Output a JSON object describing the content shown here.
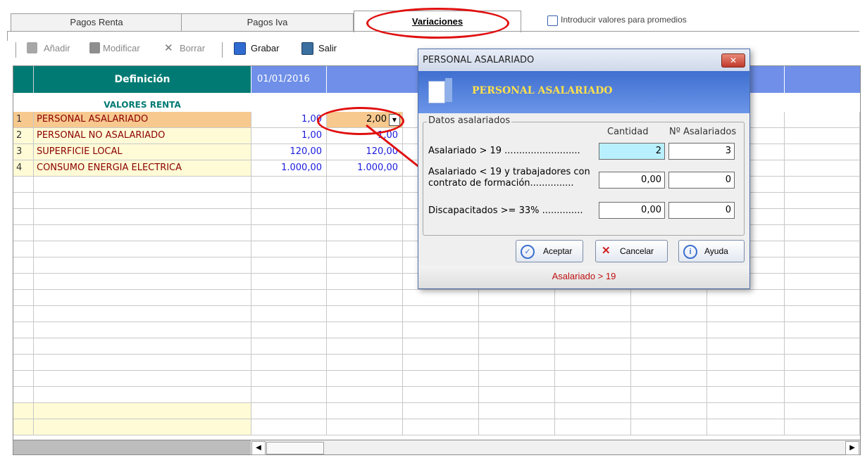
{
  "tabs": [
    {
      "label": "Pagos Renta"
    },
    {
      "label": "Pagos Iva"
    },
    {
      "label": "Variaciones"
    }
  ],
  "options": {
    "promedios_label": "Introducir valores para promedios"
  },
  "toolbar": {
    "add_label": "Añadir",
    "modify_label": "Modificar",
    "delete_label": "Borrar",
    "save_label": "Grabar",
    "exit_label": "Salir"
  },
  "grid": {
    "header": {
      "definicion": "Definición",
      "col1": "01/01/2016"
    },
    "section_title": "VALORES RENTA",
    "rows": [
      {
        "n": "1",
        "label": "PERSONAL ASALARIADO",
        "v1": "1,00",
        "v2": "2,00"
      },
      {
        "n": "2",
        "label": "PERSONAL NO ASALARIADO",
        "v1": "1,00",
        "v2": "1,00"
      },
      {
        "n": "3",
        "label": "SUPERFICIE LOCAL",
        "v1": "120,00",
        "v2": "120,00"
      },
      {
        "n": "4",
        "label": "CONSUMO ENERGIA ELECTRICA",
        "v1": "1.000,00",
        "v2": "1.000,00"
      }
    ]
  },
  "dialog": {
    "title": "PERSONAL ASALARIADO",
    "banner": "PERSONAL ASALARIADO",
    "group_label": "Datos asalariados",
    "col_cantidad": "Cantidad",
    "col_num": "Nº Asalariados",
    "rows": [
      {
        "label": "Asalariado > 19 ..........................",
        "cantidad": "2",
        "num": "3"
      },
      {
        "label": "Asalariado < 19 y trabajadores con contrato de formación...............",
        "cantidad": "0,00",
        "num": "0"
      },
      {
        "label": "Discapacitados >= 33% ..............",
        "cantidad": "0,00",
        "num": "0"
      }
    ],
    "accept_label": "Aceptar",
    "cancel_label": "Cancelar",
    "help_label": "Ayuda",
    "status": "Asalariado > 19"
  },
  "colors": {
    "accent_teal": "#007a73",
    "accent_blue": "#6f8fe8",
    "highlight_red": "#e01010",
    "row_peach": "#f7c98f"
  }
}
